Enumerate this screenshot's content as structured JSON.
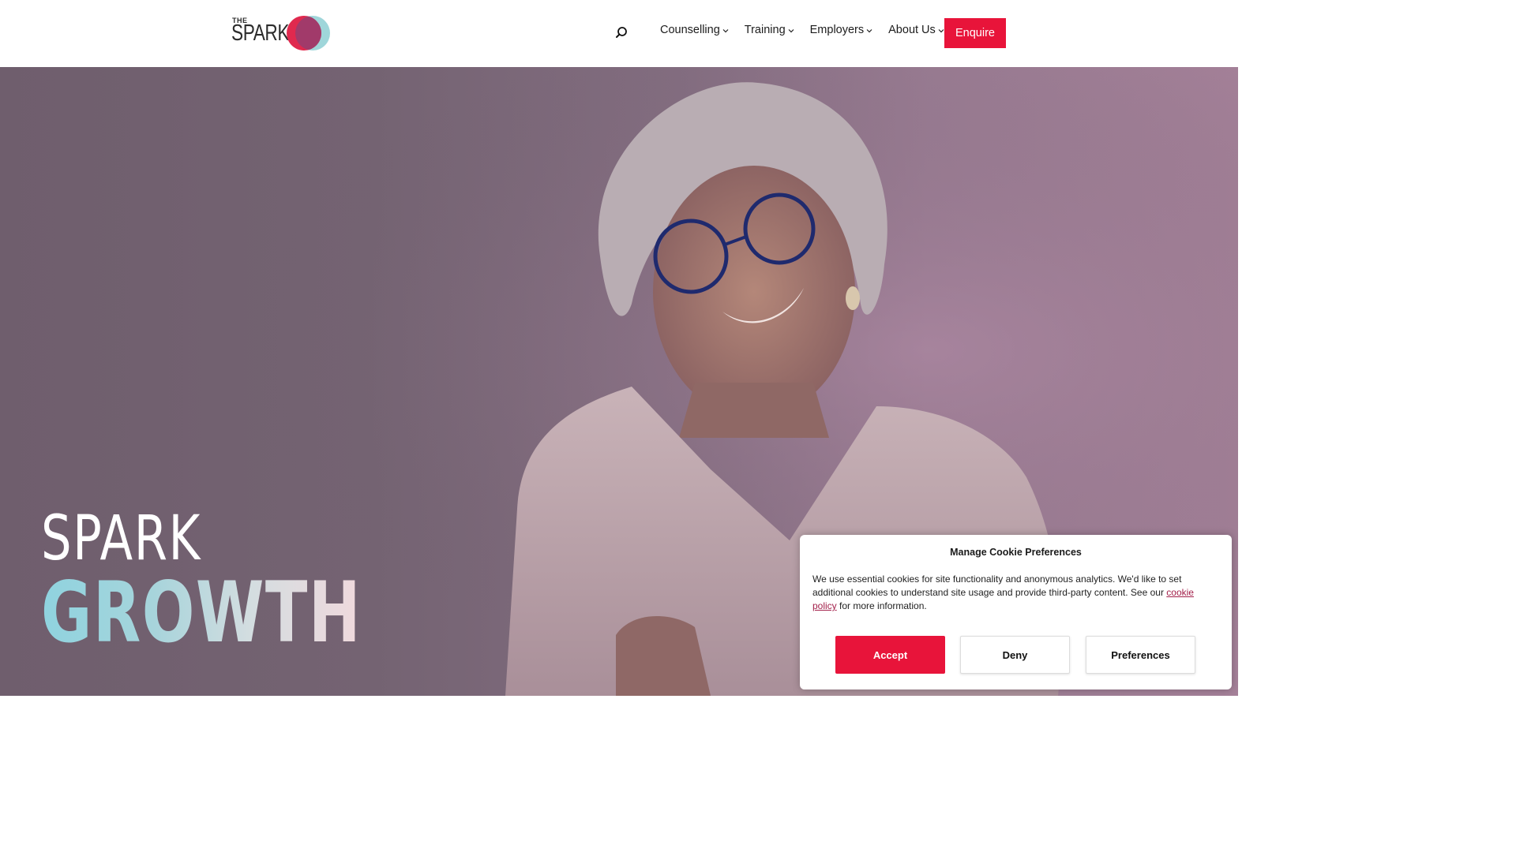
{
  "header": {
    "logo_small": "THE",
    "logo_word": "SPARK",
    "nav": [
      {
        "label": "Counselling"
      },
      {
        "label": "Training"
      },
      {
        "label": "Employers"
      },
      {
        "label": "About Us"
      }
    ],
    "enquire_label": "Enquire"
  },
  "hero": {
    "line1": "SPARK",
    "line2": "GROWTH"
  },
  "cookie_banner": {
    "title": "Manage Cookie Preferences",
    "text_before_link": "We use essential cookies for site functionality and anonymous analytics. We'd like to set additional cookies to understand site usage and provide third-party content. See our ",
    "link_text": "cookie policy",
    "text_after_link": " for more information.",
    "accept_label": "Accept",
    "deny_label": "Deny",
    "preferences_label": "Preferences"
  },
  "colors": {
    "brand_red": "#e8143a",
    "brand_teal": "#8fd3df",
    "link": "#a3214b"
  },
  "icons": {
    "search": "search-icon",
    "chevron": "chevron-down-icon"
  }
}
